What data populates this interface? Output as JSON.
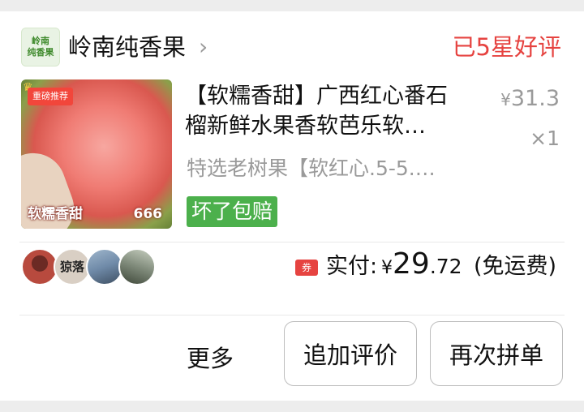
{
  "shop": {
    "logo_text": "岭南\n纯香果",
    "name": "岭南纯香果",
    "review_status": "已5星好评"
  },
  "product": {
    "image": {
      "tag": "重磅推荐",
      "overlay_text": "软糯香甜",
      "overlay_badge": "666"
    },
    "title_line1": "【软糯香甜】广西红心番石",
    "title_line2": "榴新鲜水果香软芭乐软…",
    "spec": "特选老树果【软红心.5-5.…",
    "price_symbol": "¥",
    "price_value": "31.3",
    "quantity": "×1",
    "guarantee": "坏了包赔"
  },
  "payment": {
    "coupon_icon": "券",
    "label": "实付:",
    "currency": "¥",
    "amount_int": "29",
    "amount_dec": ".72",
    "note": "(免运费)"
  },
  "avatars": [
    {
      "name": "avatar-1",
      "color": "#b84a3e"
    },
    {
      "name": "avatar-2",
      "color": "#d9cfc4",
      "text": "猄落"
    },
    {
      "name": "avatar-3",
      "color": "#6f8aa8"
    },
    {
      "name": "avatar-4",
      "color": "#7f8a7a"
    }
  ],
  "actions": {
    "more": "更多",
    "add_review": "追加评价",
    "reorder": "再次拼单"
  },
  "colors": {
    "accent_red": "#e64340",
    "guarantee_green": "#4cb04c",
    "muted_text": "#9a9a9a"
  }
}
